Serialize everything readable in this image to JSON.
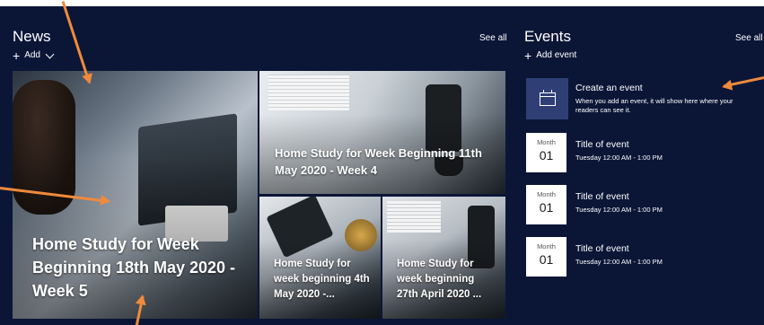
{
  "news": {
    "title": "News",
    "see_all": "See all",
    "add_label": "Add",
    "tiles": [
      {
        "caption": "Home Study for Week Beginning 18th May 2020 - Week 5"
      },
      {
        "caption": "Home Study for Week Beginning 11th May 2020 - Week 4"
      },
      {
        "caption": "Home Study for week beginning 4th May 2020 -..."
      },
      {
        "caption": "Home Study for week beginning 27th April 2020 ..."
      }
    ]
  },
  "events": {
    "title": "Events",
    "see_all": "See all",
    "add_label": "Add event",
    "create": {
      "title": "Create an event",
      "description": "When you add an event, it will show here where your readers can see it."
    },
    "items": [
      {
        "month": "Month",
        "day": "01",
        "title": "Title of event",
        "time": "Tuesday 12:00 AM - 1:00 PM"
      },
      {
        "month": "Month",
        "day": "01",
        "title": "Title of event",
        "time": "Tuesday 12:00 AM - 1:00 PM"
      },
      {
        "month": "Month",
        "day": "01",
        "title": "Title of event",
        "time": "Tuesday 12:00 AM - 1:00 PM"
      }
    ]
  },
  "colors": {
    "background": "#0b1637",
    "accent": "#2f3f75",
    "annotation_arrow": "#f08a3b"
  }
}
